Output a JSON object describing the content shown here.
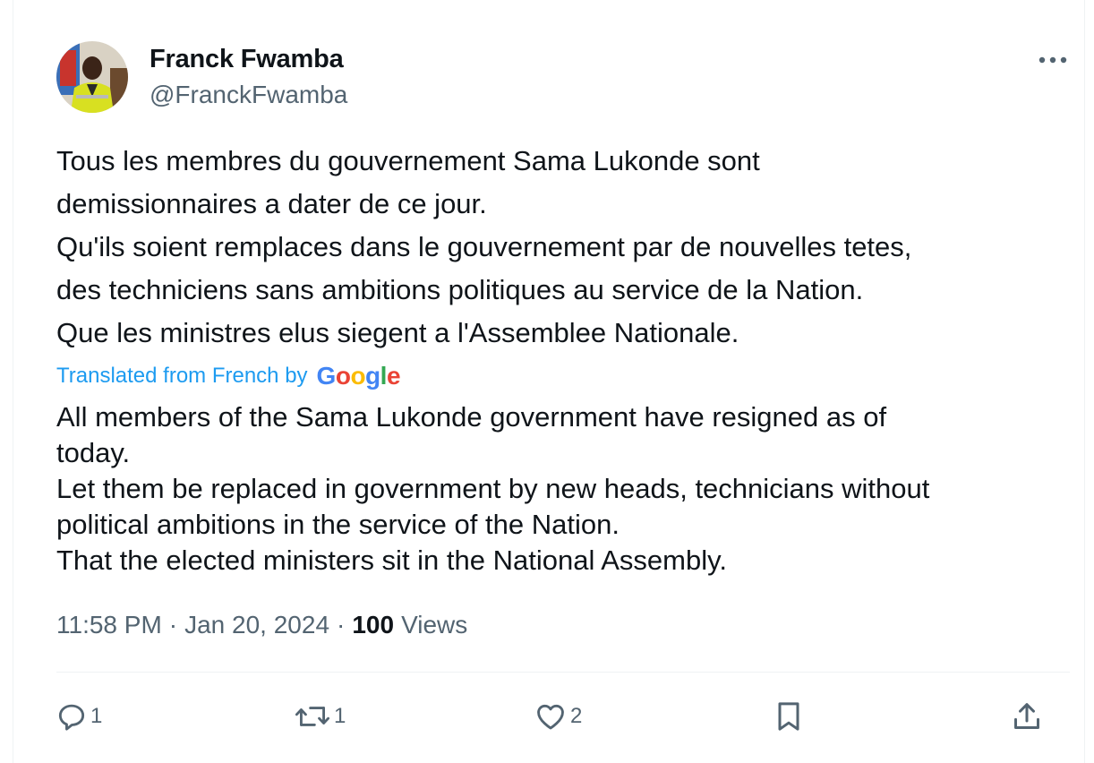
{
  "author": {
    "display_name": "Franck Fwamba",
    "handle": "@FranckFwamba",
    "avatar_icon": "avatar"
  },
  "tweet": {
    "original_lines": [
      "Tous les membres du gouvernement Sama Lukonde sont",
      "demissionnaires a dater de ce jour.",
      "Qu'ils soient remplaces dans le gouvernement par de nouvelles tetes,",
      "des techniciens sans ambitions politiques au service de la Nation.",
      "Que les ministres elus siegent a l'Assemblee Nationale."
    ],
    "translated_label": "Translated from French by",
    "translator_logo": "Google",
    "translated_lines": [
      "All members of the Sama Lukonde government have resigned as of",
      "today.",
      "Let them be replaced in government by new heads, technicians without",
      "political ambitions in the service of the Nation.",
      "That the elected ministers sit in the National Assembly."
    ]
  },
  "meta": {
    "time": "11:58 PM",
    "separator": "·",
    "date": "Jan 20, 2024",
    "views_count": "100",
    "views_label": "Views"
  },
  "actions": {
    "reply_count": "1",
    "retweet_count": "1",
    "like_count": "2"
  },
  "colors": {
    "accent": "#1d9bf0",
    "secondary_text": "#536471",
    "primary_text": "#0f1419",
    "divider": "#eff3f4"
  }
}
